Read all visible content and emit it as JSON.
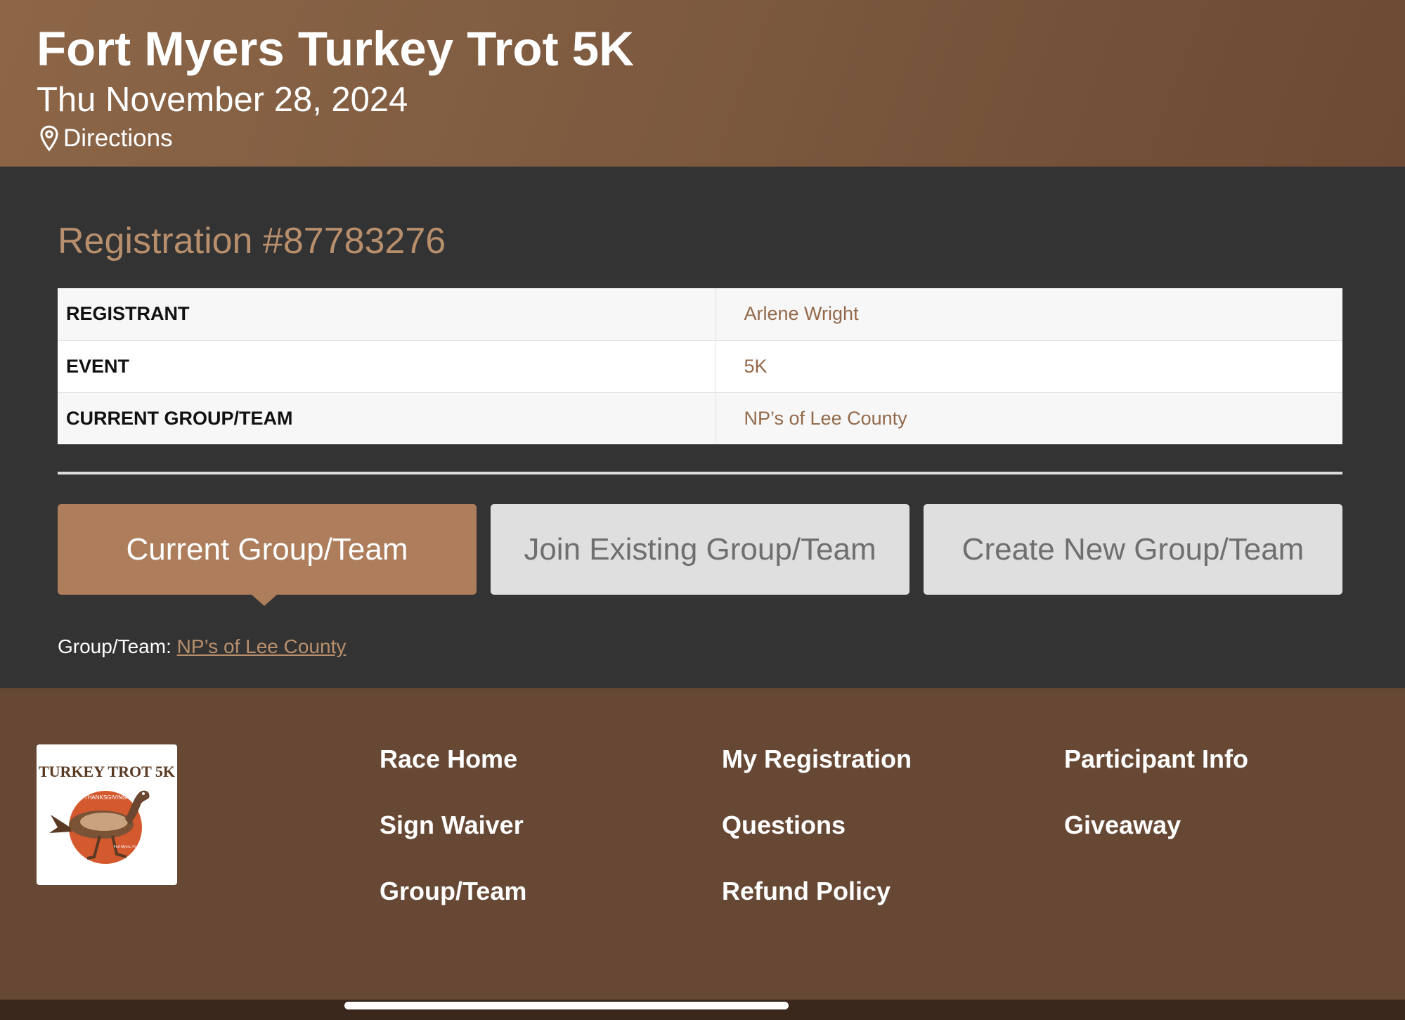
{
  "header": {
    "title": "Fort Myers Turkey Trot 5K",
    "date": "Thu November 28, 2024",
    "directions_label": "Directions"
  },
  "registration": {
    "title": "Registration #87783276",
    "rows": [
      {
        "label": "REGISTRANT",
        "value": "Arlene Wright"
      },
      {
        "label": "EVENT",
        "value": "5K"
      },
      {
        "label": "CURRENT GROUP/TEAM",
        "value": "NP’s of Lee County"
      }
    ]
  },
  "tabs": [
    {
      "label": "Current Group/Team",
      "active": true
    },
    {
      "label": "Join Existing Group/Team",
      "active": false
    },
    {
      "label": "Create New Group/Team",
      "active": false
    }
  ],
  "group_info": {
    "prefix": "Group/Team:",
    "link": "NP’s of Lee County"
  },
  "footer": {
    "logo_text": "TURKEY TROT 5K",
    "logo_subtext": "THANKSGIVING",
    "links": [
      "Race Home",
      "My Registration",
      "Participant Info",
      "Sign Waiver",
      "Questions",
      "Giveaway",
      "Group/Team",
      "Refund Policy"
    ]
  },
  "colors": {
    "header_brown": "#7a583e",
    "accent": "#ad7d5c",
    "link_text": "#b88f6d",
    "footer_brown": "#664834",
    "content_bg": "#333333"
  }
}
